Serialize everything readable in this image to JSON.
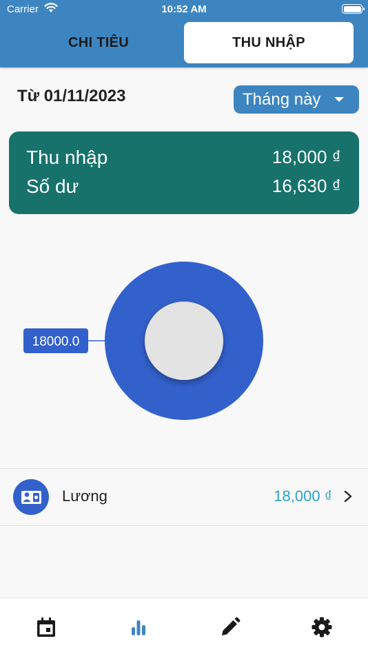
{
  "status_bar": {
    "carrier": "Carrier",
    "time": "10:52 AM"
  },
  "tabs": {
    "expense": "CHI TIÊU",
    "income": "THU NHẬP",
    "active": "income"
  },
  "filter": {
    "from_date": "Từ 01/11/2023",
    "period": "Tháng này"
  },
  "summary": {
    "income_label": "Thu nhập",
    "income_value": "18,000 ₫",
    "balance_label": "Số dư",
    "balance_value": "16,630 ₫"
  },
  "chart_data": {
    "type": "pie",
    "slices": [
      {
        "value": 18000.0,
        "label": "18000.0",
        "color": "#3361cc"
      }
    ]
  },
  "categories": [
    {
      "name": "Lương",
      "amount": "18,000 ₫",
      "icon": "id-card-icon",
      "color": "#3361cc"
    }
  ],
  "nav": {
    "items": [
      "calendar-icon",
      "bar-chart-icon",
      "pencil-icon",
      "gear-icon"
    ],
    "active": "bar-chart-icon",
    "active_color": "#3d85c0",
    "color": "#1a1a1a"
  },
  "colors": {
    "header": "#3d85c0",
    "summary_card": "#16726b",
    "amount": "#2aa4c4"
  }
}
